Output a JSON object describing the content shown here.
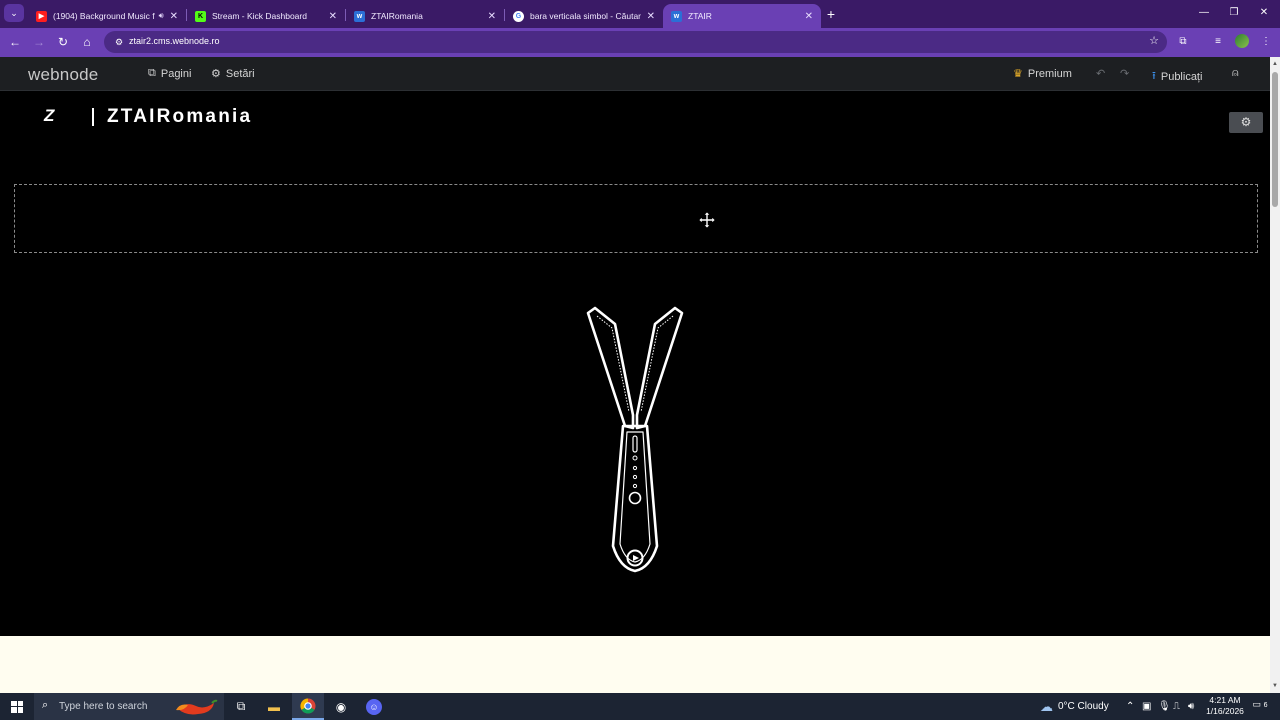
{
  "browser": {
    "tabs": [
      {
        "title": "(1904) Background Music f",
        "favicon": "youtube-icon",
        "audio": true,
        "active": false
      },
      {
        "title": "Stream - Kick Dashboard",
        "favicon": "kick-icon",
        "audio": false,
        "active": false
      },
      {
        "title": "ZTAIRomania",
        "favicon": "webnode-icon",
        "audio": false,
        "active": false
      },
      {
        "title": "bara verticala simbol - Căutare",
        "favicon": "google-icon",
        "audio": false,
        "active": false
      },
      {
        "title": "ZTAIR",
        "favicon": "webnode-icon",
        "audio": false,
        "active": true
      }
    ],
    "url": "ztair2.cms.webnode.ro"
  },
  "editor": {
    "logo": "webnode",
    "pages_label": "Pagini",
    "settings_label": "Setări",
    "premium_label": "Premium",
    "publish_label": "Publicați"
  },
  "site": {
    "logo_mark": "Z",
    "title": "ZTAIRomania"
  },
  "taskbar": {
    "search_placeholder": "Type here to search",
    "weather": "0°C  Cloudy",
    "time": "4:21 AM",
    "date": "1/16/2026",
    "notifications": "6"
  },
  "colors": {
    "tab_strip": "#3a1a66",
    "toolbar": "#6a40b4",
    "editor_bar": "#1d1f22",
    "canvas": "#000000",
    "light_section": "#fffdf0",
    "premium_accent": "#f0b429",
    "publish_accent": "#3b8ee8"
  }
}
